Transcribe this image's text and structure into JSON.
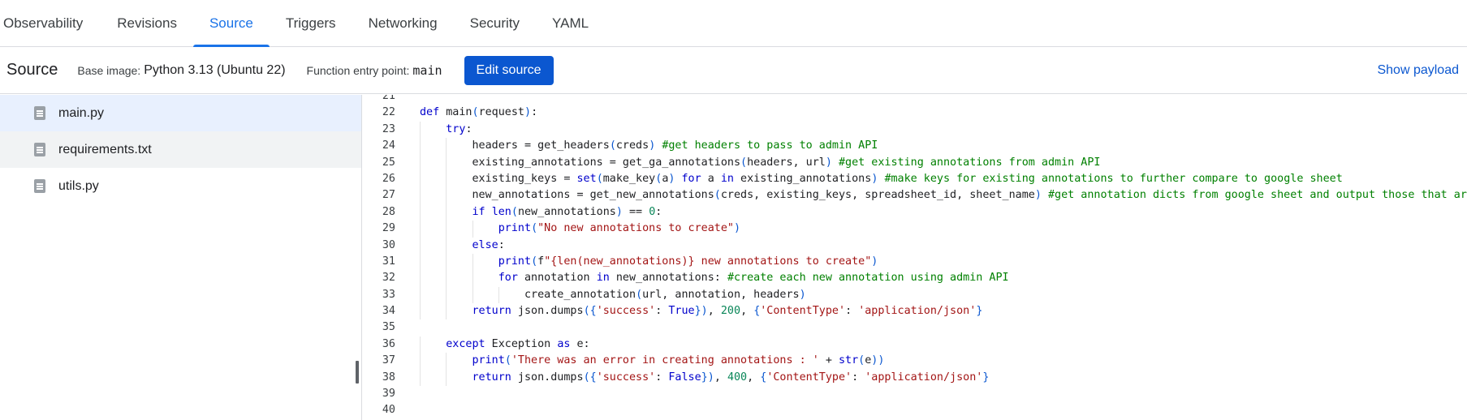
{
  "tabs": [
    {
      "label": "Observability",
      "active": false
    },
    {
      "label": "Revisions",
      "active": false
    },
    {
      "label": "Source",
      "active": true
    },
    {
      "label": "Triggers",
      "active": false
    },
    {
      "label": "Networking",
      "active": false
    },
    {
      "label": "Security",
      "active": false
    },
    {
      "label": "YAML",
      "active": false
    }
  ],
  "source_bar": {
    "title": "Source",
    "base_image_label": "Base image:",
    "base_image_value": "Python 3.13 (Ubuntu 22)",
    "entry_point_label": "Function entry point:",
    "entry_point_value": "main",
    "edit_button": "Edit source",
    "show_payload": "Show payload"
  },
  "files": [
    {
      "name": "main.py",
      "state": "selected"
    },
    {
      "name": "requirements.txt",
      "state": "hover"
    },
    {
      "name": "utils.py",
      "state": "normal"
    }
  ],
  "colors": {
    "accent": "#1a73e8",
    "button": "#0b57d0",
    "selected_file_bg": "#e8f0fe"
  },
  "code": {
    "lines": [
      {
        "n": "21",
        "indent": 0,
        "tokens": []
      },
      {
        "n": "22",
        "indent": 0,
        "tokens": [
          [
            "kw",
            "def"
          ],
          [
            "t",
            " main"
          ],
          [
            "fn",
            "("
          ],
          [
            "t",
            "request"
          ],
          [
            "fn",
            ")"
          ],
          [
            "t",
            ":"
          ]
        ]
      },
      {
        "n": "23",
        "indent": 1,
        "tokens": [
          [
            "kw",
            "try"
          ],
          [
            "t",
            ":"
          ]
        ]
      },
      {
        "n": "24",
        "indent": 2,
        "tokens": [
          [
            "t",
            "headers = get_headers"
          ],
          [
            "fn",
            "("
          ],
          [
            "t",
            "creds"
          ],
          [
            "fn",
            ")"
          ],
          [
            "t",
            " "
          ],
          [
            "cm",
            "#get headers to pass to admin API"
          ]
        ]
      },
      {
        "n": "25",
        "indent": 2,
        "tokens": [
          [
            "t",
            "existing_annotations = get_ga_annotations"
          ],
          [
            "fn",
            "("
          ],
          [
            "t",
            "headers, url"
          ],
          [
            "fn",
            ")"
          ],
          [
            "t",
            " "
          ],
          [
            "cm",
            "#get existing annotations from admin API"
          ]
        ]
      },
      {
        "n": "26",
        "indent": 2,
        "tokens": [
          [
            "t",
            "existing_keys = "
          ],
          [
            "bi",
            "set"
          ],
          [
            "fn",
            "("
          ],
          [
            "t",
            "make_key"
          ],
          [
            "fn",
            "("
          ],
          [
            "t",
            "a"
          ],
          [
            "fn",
            ")"
          ],
          [
            "t",
            " "
          ],
          [
            "kw",
            "for"
          ],
          [
            "t",
            " a "
          ],
          [
            "kw",
            "in"
          ],
          [
            "t",
            " existing_annotations"
          ],
          [
            "fn",
            ")"
          ],
          [
            "t",
            " "
          ],
          [
            "cm",
            "#make keys for existing annotations to further compare to google sheet"
          ]
        ]
      },
      {
        "n": "27",
        "indent": 2,
        "tokens": [
          [
            "t",
            "new_annotations = get_new_annotations"
          ],
          [
            "fn",
            "("
          ],
          [
            "t",
            "creds, existing_keys, spreadsheet_id, sheet_name"
          ],
          [
            "fn",
            ")"
          ],
          [
            "t",
            " "
          ],
          [
            "cm",
            "#get annotation dicts from google sheet and output those that aren't already in admin API"
          ]
        ]
      },
      {
        "n": "28",
        "indent": 2,
        "tokens": [
          [
            "kw",
            "if"
          ],
          [
            "t",
            " "
          ],
          [
            "bi",
            "len"
          ],
          [
            "fn",
            "("
          ],
          [
            "t",
            "new_annotations"
          ],
          [
            "fn",
            ")"
          ],
          [
            "t",
            " == "
          ],
          [
            "num",
            "0"
          ],
          [
            "t",
            ":"
          ]
        ]
      },
      {
        "n": "29",
        "indent": 3,
        "tokens": [
          [
            "bi",
            "print"
          ],
          [
            "fn",
            "("
          ],
          [
            "str",
            "\"No new annotations to create\""
          ],
          [
            "fn",
            ")"
          ]
        ]
      },
      {
        "n": "30",
        "indent": 2,
        "tokens": [
          [
            "kw",
            "else"
          ],
          [
            "t",
            ":"
          ]
        ]
      },
      {
        "n": "31",
        "indent": 3,
        "tokens": [
          [
            "bi",
            "print"
          ],
          [
            "fn",
            "("
          ],
          [
            "t",
            "f"
          ],
          [
            "str",
            "\"{len(new_annotations)} new annotations to create\""
          ],
          [
            "fn",
            ")"
          ]
        ]
      },
      {
        "n": "32",
        "indent": 3,
        "tokens": [
          [
            "kw",
            "for"
          ],
          [
            "t",
            " annotation "
          ],
          [
            "kw",
            "in"
          ],
          [
            "t",
            " new_annotations: "
          ],
          [
            "cm",
            "#create each new annotation using admin API"
          ]
        ]
      },
      {
        "n": "33",
        "indent": 4,
        "tokens": [
          [
            "t",
            "create_annotation"
          ],
          [
            "fn",
            "("
          ],
          [
            "t",
            "url, annotation, headers"
          ],
          [
            "fn",
            ")"
          ]
        ]
      },
      {
        "n": "34",
        "indent": 2,
        "tokens": [
          [
            "kw",
            "return"
          ],
          [
            "t",
            " json.dumps"
          ],
          [
            "fn",
            "({"
          ],
          [
            "str",
            "'success'"
          ],
          [
            "t",
            ": "
          ],
          [
            "kw",
            "True"
          ],
          [
            "fn",
            "})"
          ],
          [
            "t",
            ", "
          ],
          [
            "num",
            "200"
          ],
          [
            "t",
            ", "
          ],
          [
            "fn",
            "{"
          ],
          [
            "str",
            "'ContentType'"
          ],
          [
            "t",
            ": "
          ],
          [
            "str",
            "'application/json'"
          ],
          [
            "fn",
            "}"
          ]
        ]
      },
      {
        "n": "35",
        "indent": 0,
        "tokens": []
      },
      {
        "n": "36",
        "indent": 1,
        "tokens": [
          [
            "kw",
            "except"
          ],
          [
            "t",
            " Exception "
          ],
          [
            "kw",
            "as"
          ],
          [
            "t",
            " e:"
          ]
        ]
      },
      {
        "n": "37",
        "indent": 2,
        "tokens": [
          [
            "bi",
            "print"
          ],
          [
            "fn",
            "("
          ],
          [
            "str",
            "'There was an error in creating annotations : '"
          ],
          [
            "t",
            " + "
          ],
          [
            "bi",
            "str"
          ],
          [
            "fn",
            "("
          ],
          [
            "t",
            "e"
          ],
          [
            "fn",
            "))"
          ]
        ]
      },
      {
        "n": "38",
        "indent": 2,
        "tokens": [
          [
            "kw",
            "return"
          ],
          [
            "t",
            " json.dumps"
          ],
          [
            "fn",
            "({"
          ],
          [
            "str",
            "'success'"
          ],
          [
            "t",
            ": "
          ],
          [
            "kw",
            "False"
          ],
          [
            "fn",
            "})"
          ],
          [
            "t",
            ", "
          ],
          [
            "num",
            "400"
          ],
          [
            "t",
            ", "
          ],
          [
            "fn",
            "{"
          ],
          [
            "str",
            "'ContentType'"
          ],
          [
            "t",
            ": "
          ],
          [
            "str",
            "'application/json'"
          ],
          [
            "fn",
            "}"
          ]
        ]
      },
      {
        "n": "39",
        "indent": 0,
        "tokens": []
      },
      {
        "n": "40",
        "indent": 0,
        "tokens": []
      }
    ]
  }
}
